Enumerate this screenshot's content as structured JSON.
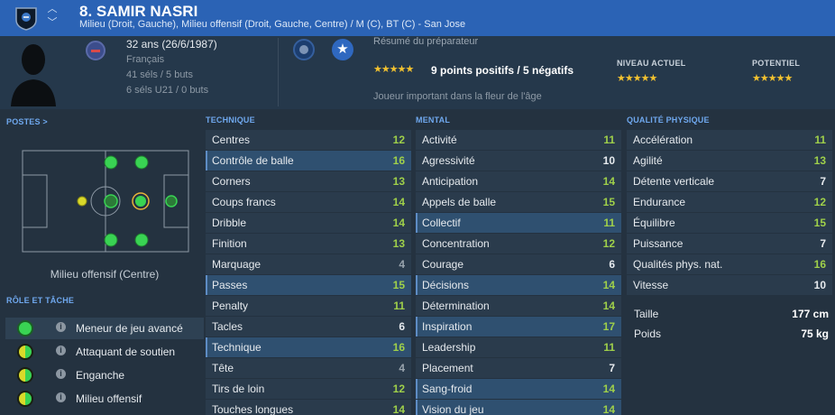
{
  "header": {
    "number_name": "8. SAMIR NASRI",
    "positions": "Milieu (Droit, Gauche), Milieu offensif (Droit, Gauche, Centre) / M (C), BT (C) - San Jose",
    "arrow_up": "︿",
    "arrow_down": "﹀"
  },
  "profile": {
    "age": "32 ans (26/6/1987)",
    "nationality": "Français",
    "caps": "41 séls / 5 buts",
    "caps_u21": "6 séls U21 / 0 buts"
  },
  "scout": {
    "title": "Résumé du préparateur",
    "stars": "★★★★★",
    "rating_stars": 4.5,
    "summary": "9 points positifs / 5 négatifs",
    "note": "Joueur important dans la fleur de l'âge",
    "star_badge": "★"
  },
  "levels": {
    "current_label": "NIVEAU ACTUEL",
    "current_stars": "★★★★★",
    "current_rating": 4.5,
    "potential_label": "POTENTIEL",
    "potential_stars": "★★★★★",
    "potential_rating": 4.5
  },
  "positions_section": {
    "title": "POSTES >",
    "caption": "Milieu offensif (Centre)"
  },
  "role_section": {
    "title": "RÔLE ET TÂCHE",
    "info_glyph": "i",
    "roles": [
      {
        "label": "Meneur de jeu avancé"
      },
      {
        "label": "Attaquant de soutien"
      },
      {
        "label": "Enganche"
      },
      {
        "label": "Milieu offensif"
      }
    ]
  },
  "technique": {
    "title": "TECHNIQUE",
    "rows": [
      {
        "name": "Centres",
        "value": "12"
      },
      {
        "name": "Contrôle de balle",
        "value": "16"
      },
      {
        "name": "Corners",
        "value": "13"
      },
      {
        "name": "Coups francs",
        "value": "14"
      },
      {
        "name": "Dribble",
        "value": "14"
      },
      {
        "name": "Finition",
        "value": "13"
      },
      {
        "name": "Marquage",
        "value": "4"
      },
      {
        "name": "Passes",
        "value": "15"
      },
      {
        "name": "Penalty",
        "value": "11"
      },
      {
        "name": "Tacles",
        "value": "6"
      },
      {
        "name": "Technique",
        "value": "16"
      },
      {
        "name": "Tête",
        "value": "4"
      },
      {
        "name": "Tirs de loin",
        "value": "12"
      },
      {
        "name": "Touches longues",
        "value": "14"
      }
    ]
  },
  "mental": {
    "title": "MENTAL",
    "rows": [
      {
        "name": "Activité",
        "value": "11"
      },
      {
        "name": "Agressivité",
        "value": "10"
      },
      {
        "name": "Anticipation",
        "value": "14"
      },
      {
        "name": "Appels de balle",
        "value": "15"
      },
      {
        "name": "Collectif",
        "value": "11"
      },
      {
        "name": "Concentration",
        "value": "12"
      },
      {
        "name": "Courage",
        "value": "6"
      },
      {
        "name": "Décisions",
        "value": "14"
      },
      {
        "name": "Détermination",
        "value": "14"
      },
      {
        "name": "Inspiration",
        "value": "17"
      },
      {
        "name": "Leadership",
        "value": "11"
      },
      {
        "name": "Placement",
        "value": "7"
      },
      {
        "name": "Sang-froid",
        "value": "14"
      },
      {
        "name": "Vision du jeu",
        "value": "14"
      }
    ]
  },
  "physical": {
    "title": "QUALITÉ PHYSIQUE",
    "rows": [
      {
        "name": "Accélération",
        "value": "11"
      },
      {
        "name": "Agilité",
        "value": "13"
      },
      {
        "name": "Détente verticale",
        "value": "7"
      },
      {
        "name": "Endurance",
        "value": "12"
      },
      {
        "name": "Équilibre",
        "value": "15"
      },
      {
        "name": "Puissance",
        "value": "7"
      },
      {
        "name": "Qualités phys. nat.",
        "value": "16"
      },
      {
        "name": "Vitesse",
        "value": "10"
      }
    ],
    "height_label": "Taille",
    "height_value": "177 cm",
    "weight_label": "Poids",
    "weight_value": "75 kg"
  },
  "colors": {
    "header_blue": "#2b63b5",
    "accent_green": "#9fd04a",
    "star_gold": "#f2c230",
    "role_green": "#39d353",
    "role_yellow": "#d9d92a"
  }
}
